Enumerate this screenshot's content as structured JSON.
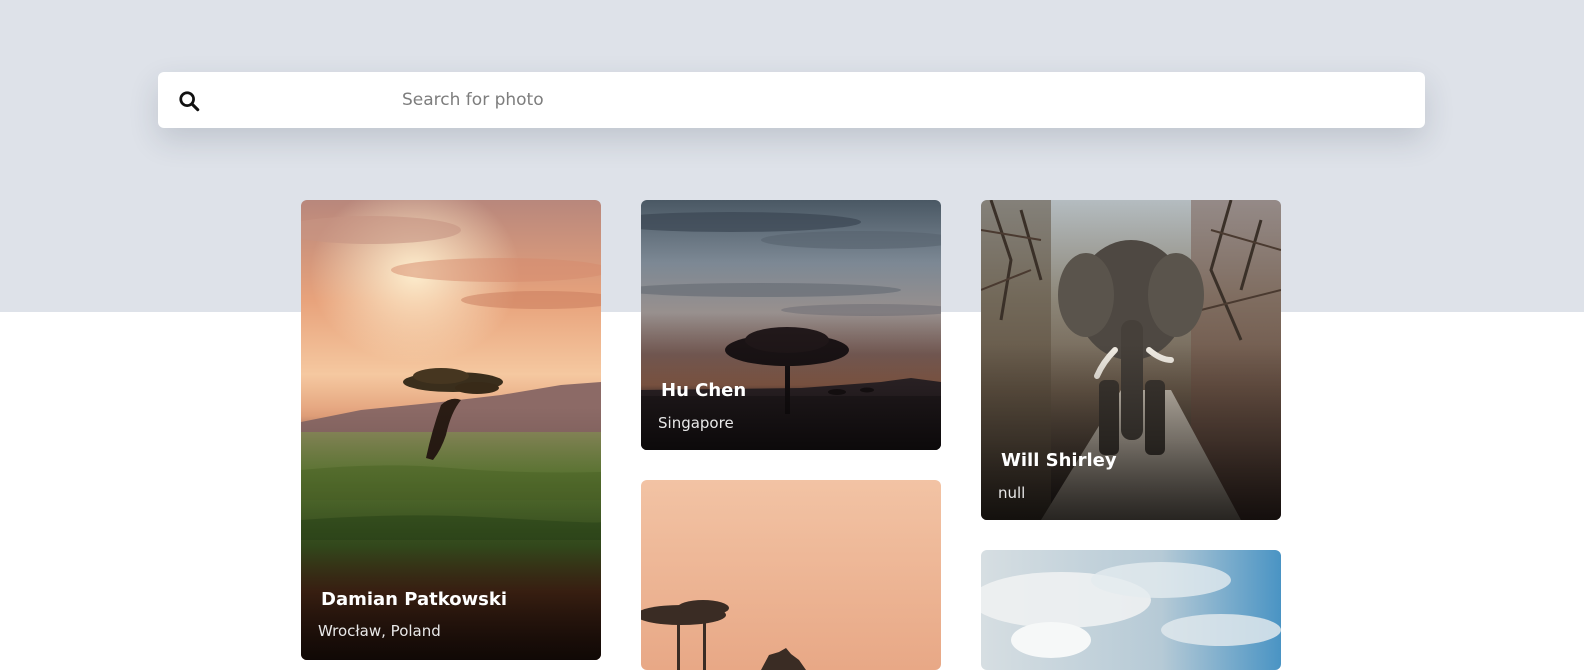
{
  "search": {
    "placeholder": "Search for photo",
    "value": "",
    "icon": "search-icon"
  },
  "colors": {
    "hero_background": "#dee2e9",
    "page_background": "#ffffff",
    "card_text": "#ffffff"
  },
  "photos": [
    {
      "name": "Damian Patkowski",
      "location": "Wrocław, Poland"
    },
    {
      "name": "Hu Chen",
      "location": "Singapore"
    },
    {
      "name": "Will Shirley",
      "location": "null"
    },
    {
      "name": "",
      "location": ""
    },
    {
      "name": "",
      "location": ""
    }
  ]
}
